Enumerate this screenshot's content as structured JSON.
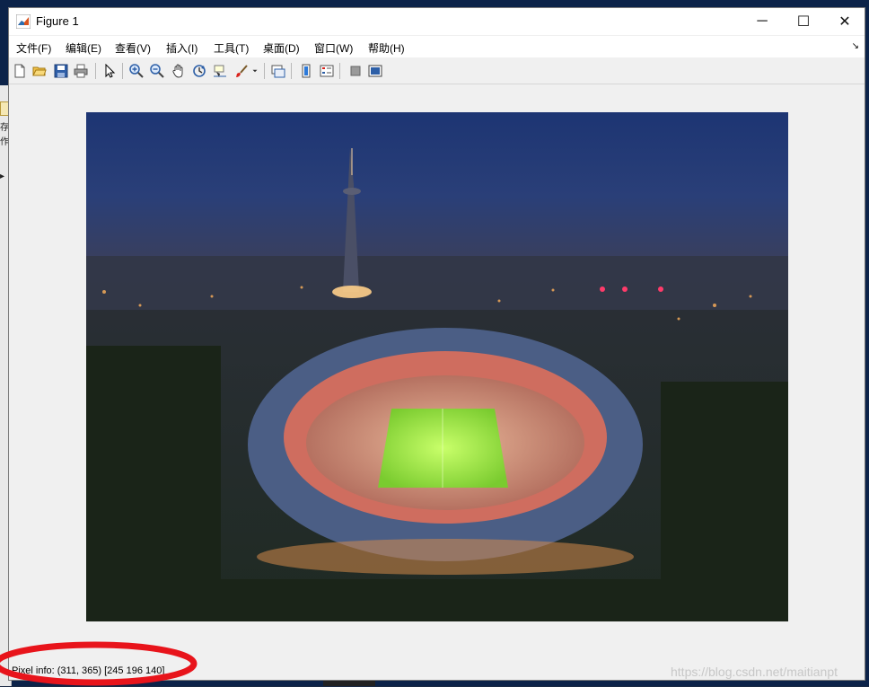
{
  "window": {
    "title": "Figure 1",
    "minimize_symbol": "─",
    "maximize_symbol": "☐",
    "close_symbol": "✕"
  },
  "menu": {
    "items": [
      {
        "label": "文件(F)"
      },
      {
        "label": "编辑(E)"
      },
      {
        "label": "查看(V)"
      },
      {
        "label": "插入(I)"
      },
      {
        "label": "工具(T)"
      },
      {
        "label": "桌面(D)"
      },
      {
        "label": "窗口(W)"
      },
      {
        "label": "帮助(H)"
      }
    ],
    "dock_symbol": "↘"
  },
  "toolbar": {
    "buttons": [
      {
        "icon": "new-figure-icon"
      },
      {
        "icon": "open-file-icon"
      },
      {
        "icon": "save-icon"
      },
      {
        "icon": "print-icon"
      },
      {
        "icon": "edit-plot-icon"
      },
      {
        "icon": "zoom-in-icon"
      },
      {
        "icon": "zoom-out-icon"
      },
      {
        "icon": "pan-icon"
      },
      {
        "icon": "rotate-3d-icon"
      },
      {
        "icon": "data-cursor-icon"
      },
      {
        "icon": "brush-icon"
      },
      {
        "icon": "link-plot-icon"
      },
      {
        "icon": "colorbar-icon"
      },
      {
        "icon": "legend-icon"
      },
      {
        "icon": "hide-plot-tools-icon"
      },
      {
        "icon": "show-plot-tools-icon"
      }
    ]
  },
  "status": {
    "pixel_info": "Pixel info: (311, 365)  [245 196 140]"
  },
  "watermark": "https://blog.csdn.net/maitianpt",
  "colors": {
    "annotation_red": "#e8141b",
    "sky_top": "#1d3573",
    "field_green": "#8be03a"
  }
}
